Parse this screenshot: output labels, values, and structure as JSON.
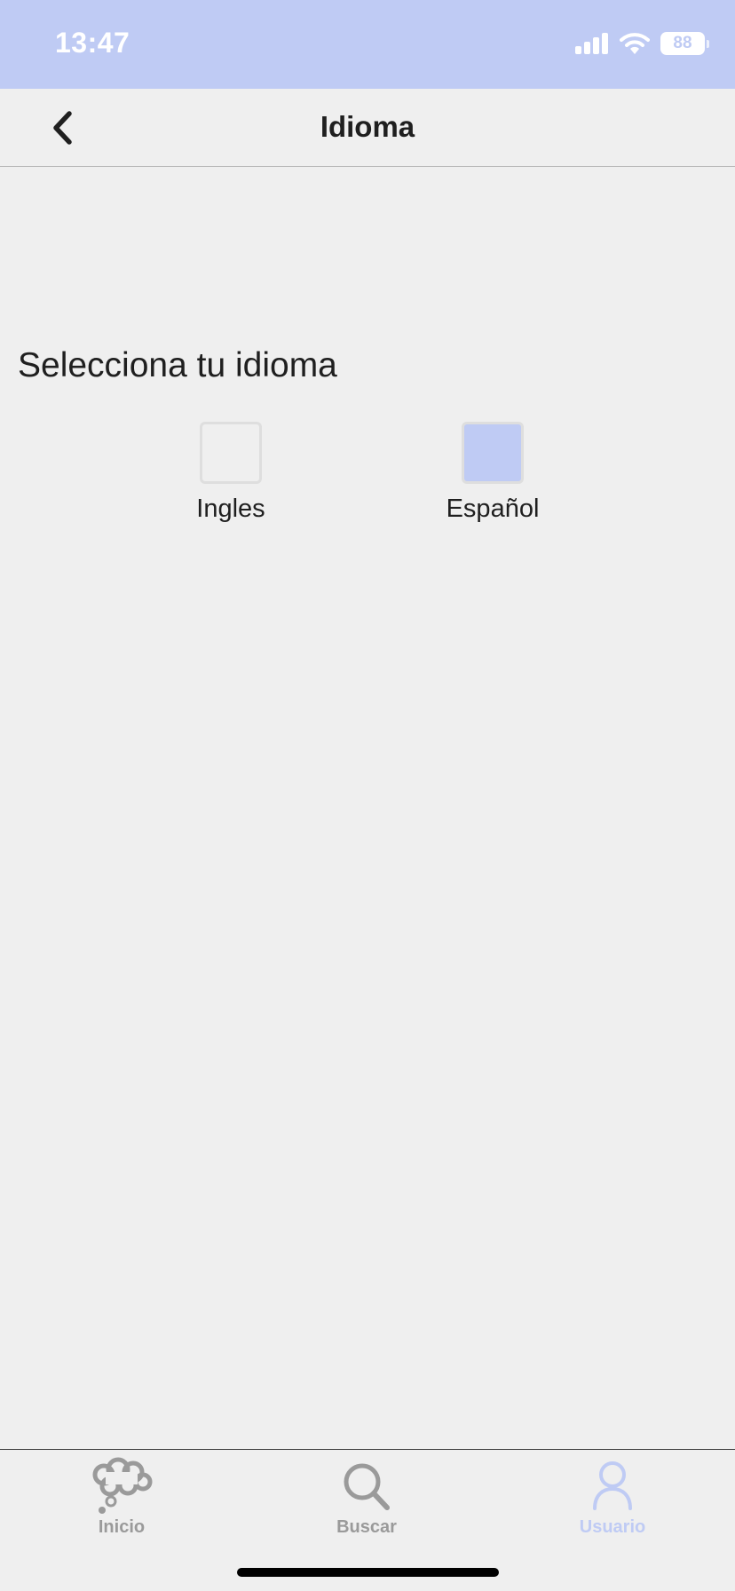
{
  "status_bar": {
    "time": "13:47",
    "battery_level": "88",
    "icons": [
      "signal-icon",
      "wifi-icon",
      "battery-icon"
    ],
    "background_color": "#bfcbf4"
  },
  "nav": {
    "title": "Idioma",
    "back_icon": "chevron-left-icon"
  },
  "content": {
    "section_title": "Selecciona tu idioma",
    "options": [
      {
        "label": "Ingles",
        "selected": false
      },
      {
        "label": "Español",
        "selected": true
      }
    ],
    "selected_color": "#bfcbf4"
  },
  "tabs": [
    {
      "label": "Inicio",
      "icon": "thought-cloud-icon",
      "active": false
    },
    {
      "label": "Buscar",
      "icon": "search-icon",
      "active": false
    },
    {
      "label": "Usuario",
      "icon": "user-icon",
      "active": true
    }
  ],
  "colors": {
    "background": "#efefef",
    "accent": "#bfcbf4",
    "inactive_tab": "#9a9a9a"
  }
}
